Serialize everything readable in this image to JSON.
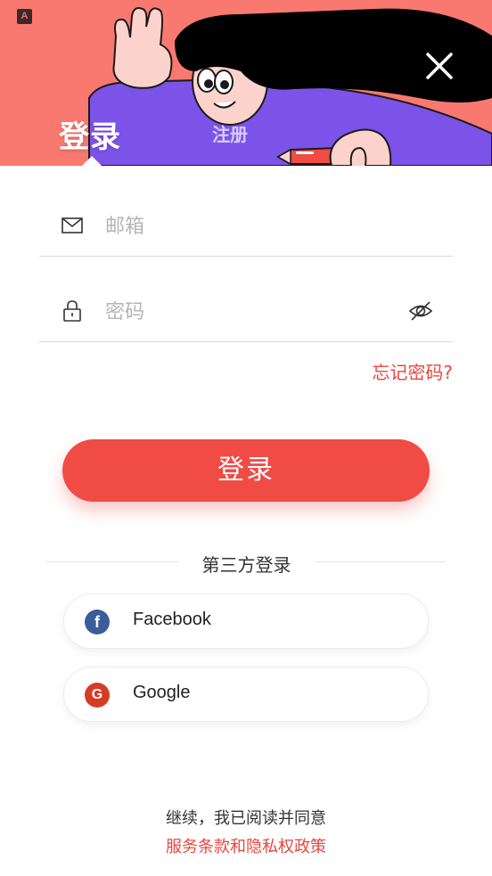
{
  "header": {
    "app_logo_text": "A",
    "tabs": [
      {
        "label": "登录",
        "active": true
      },
      {
        "label": "注册",
        "active": false
      }
    ],
    "close_icon": "close-icon"
  },
  "form": {
    "email": {
      "placeholder": "邮箱",
      "value": "",
      "icon": "mail-icon"
    },
    "password": {
      "placeholder": "密码",
      "value": "",
      "icon": "lock-icon",
      "toggle_icon": "eye-off-icon"
    },
    "forgot_label": "忘记密码?"
  },
  "login_button": {
    "label": "登录"
  },
  "third_party": {
    "title": "第三方登录",
    "providers": [
      {
        "label": "Facebook",
        "icon": "facebook-icon",
        "icon_text": "f",
        "color": "#3b5c9a"
      },
      {
        "label": "Google",
        "icon": "google-icon",
        "icon_text": "G",
        "color": "#d63b26"
      }
    ]
  },
  "footer": {
    "agree_text": "继续，我已阅读并同意",
    "terms_link": "服务条款和隐私权政策"
  },
  "colors": {
    "header_bg": "#f97970",
    "accent": "#f04b45",
    "link": "#e8463f",
    "illustration_purple": "#7c53e8"
  }
}
